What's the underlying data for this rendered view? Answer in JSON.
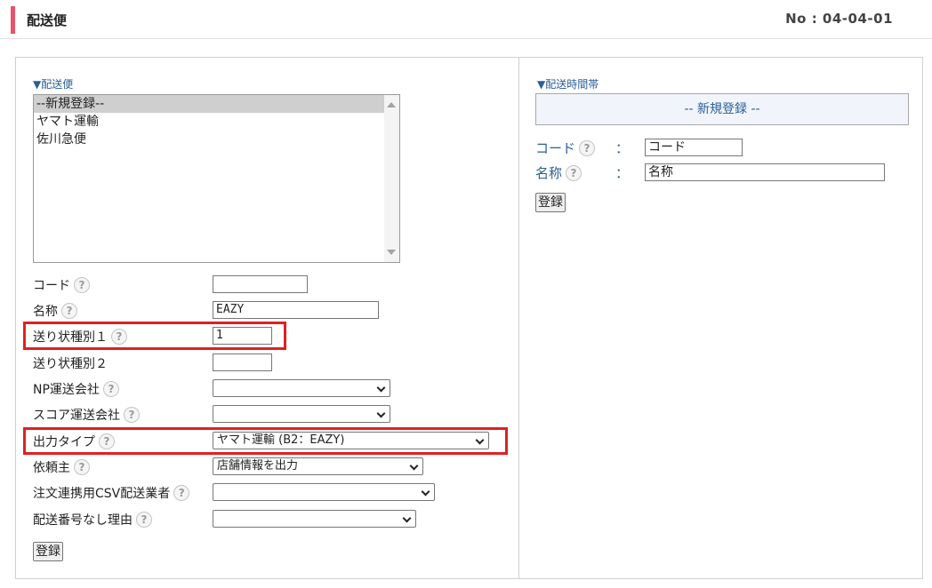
{
  "colors": {
    "accent": "#e8536a",
    "link": "#2a5e96",
    "highlight": "#e02020",
    "selected_bg": "#cfcfcf"
  },
  "header": {
    "title": "配送便",
    "page_no": "No : 04-04-01"
  },
  "left": {
    "section_label": "▼配送便",
    "list_items": [
      "--新規登録--",
      "ヤマト運輸",
      "佐川急便"
    ],
    "form": {
      "code_label": "コード",
      "code_value": "",
      "name_label": "名称",
      "name_value": "EAZY",
      "slip1_label": "送り状種別１",
      "slip1_value": "1",
      "slip2_label": "送り状種別２",
      "slip2_value": "",
      "np_label": "NP運送会社",
      "np_value": "",
      "score_label": "スコア運送会社",
      "score_value": "",
      "output_label": "出力タイプ",
      "output_value": "ヤマト運輸 (B2：EAZY)",
      "client_label": "依頼主",
      "client_value": "店舗情報を出力",
      "csv_label": "注文連携用CSV配送業者",
      "csv_value": "",
      "reason_label": "配送番号なし理由",
      "reason_value": ""
    },
    "register_label": "登録"
  },
  "right": {
    "section_label": "▼配送時間帯",
    "new_label": "-- 新規登録 --",
    "code_label": "コード",
    "code_value": "コード",
    "name_label": "名称",
    "name_value": "名称",
    "colon": "：",
    "register_label": "登録"
  },
  "help_glyph": "?"
}
